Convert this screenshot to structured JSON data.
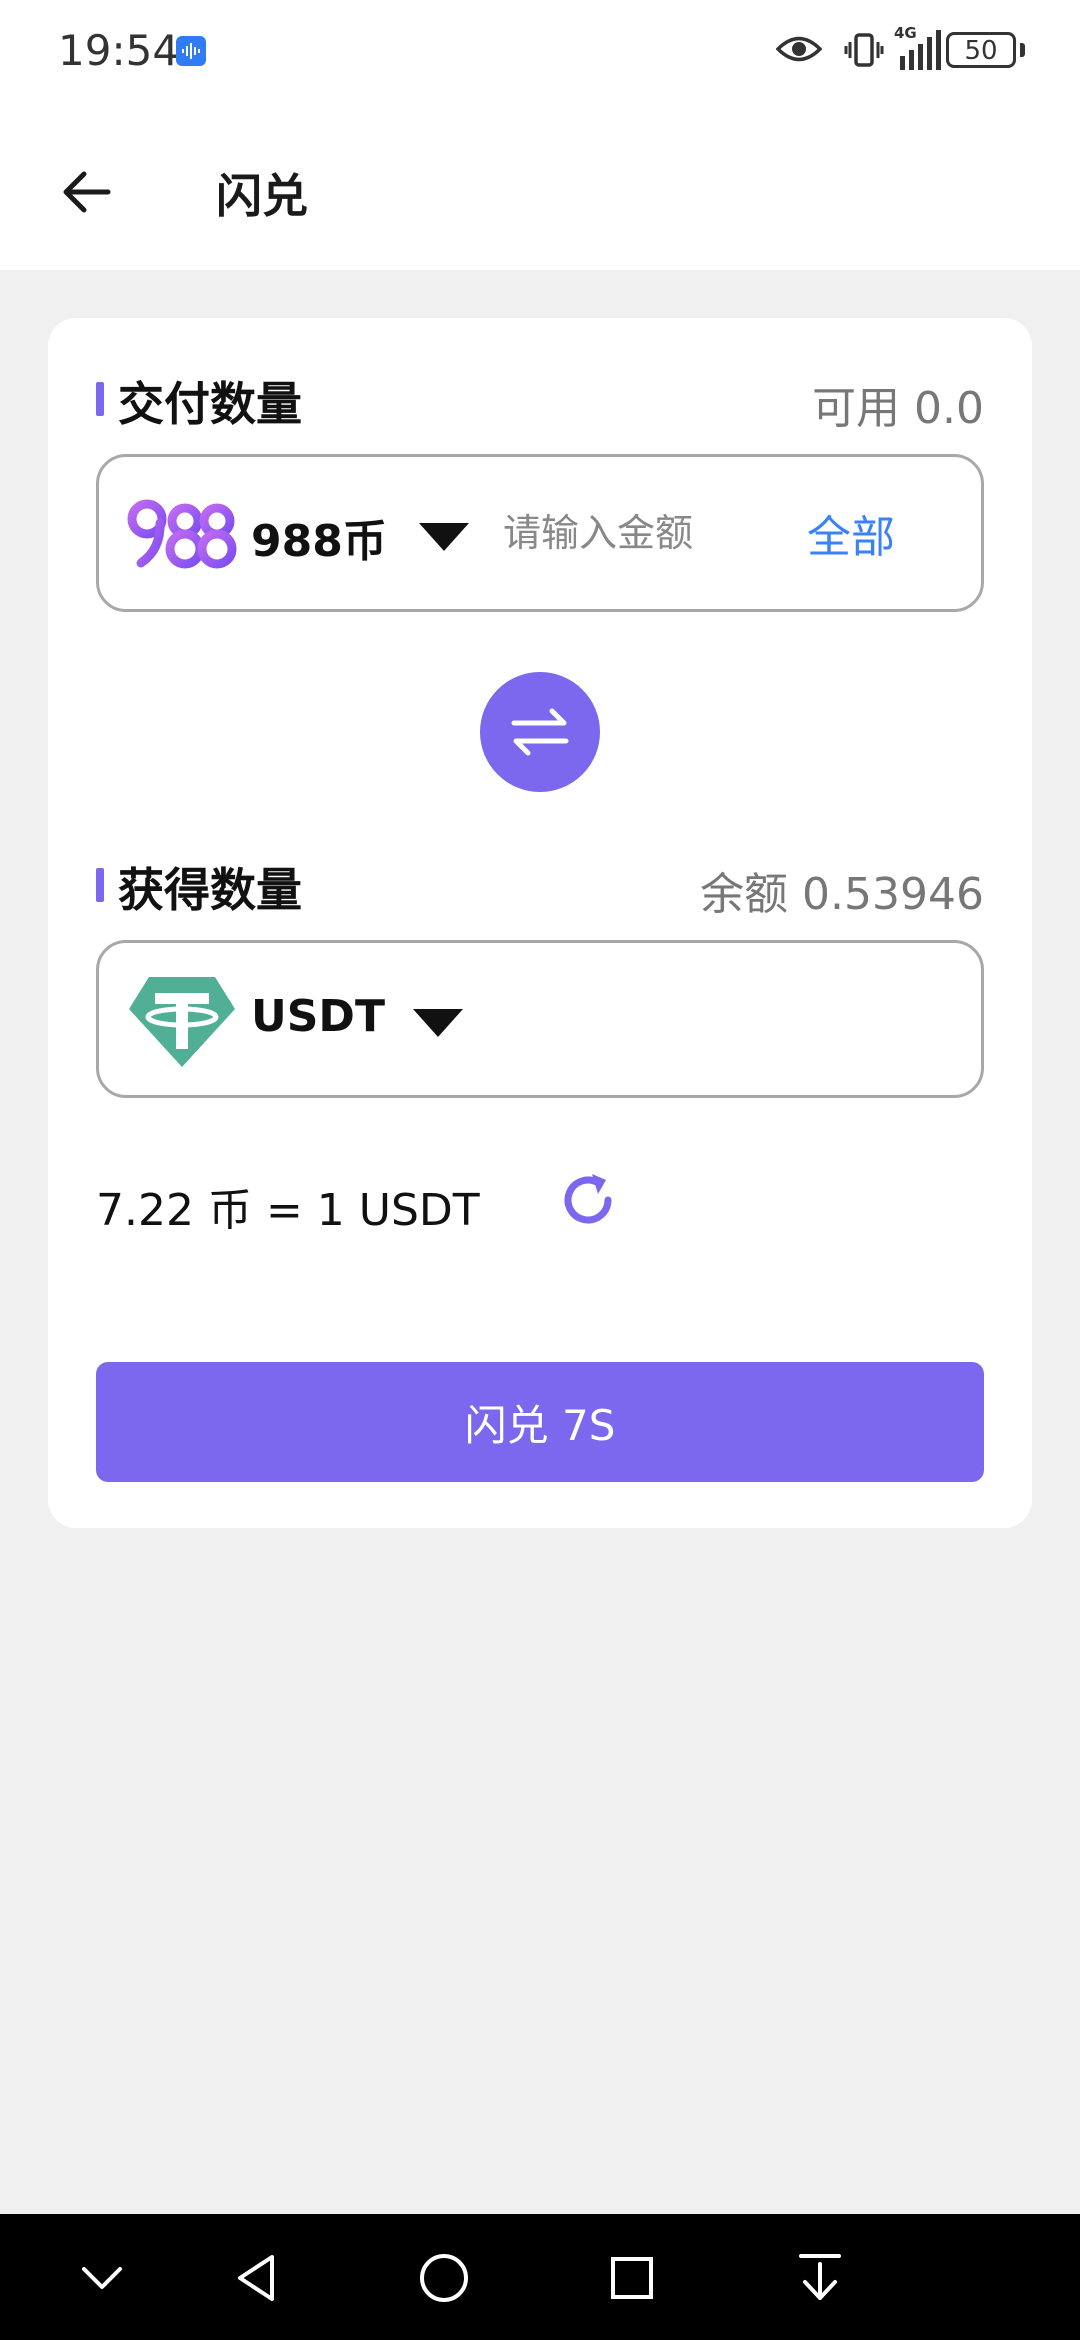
{
  "status_bar": {
    "time": "19:54",
    "network": "4G",
    "battery": "50",
    "icons": [
      "voice-icon",
      "eye-icon",
      "vibrate-icon",
      "signal-icon",
      "battery-icon"
    ]
  },
  "header": {
    "title": "闪兑",
    "back_icon": "arrow-left-icon"
  },
  "pay_section": {
    "title": "交付数量",
    "available": "可用 0.0",
    "coin_name": "988币",
    "amount_value": "",
    "amount_placeholder": "请输入金额",
    "all_label": "全部"
  },
  "receive_section": {
    "title": "获得数量",
    "balance": "余额 0.53946",
    "coin_name": "USDT"
  },
  "rate": {
    "text": "7.22 币 = 1 USDT"
  },
  "exchange_button": {
    "label": "闪兑 7S"
  },
  "colors": {
    "accent": "#7b68ee",
    "link": "#3b82f6",
    "tether": "#50af95",
    "background": "#f0f0f0"
  },
  "nav_bar": {
    "icons": [
      "chevron-down-icon",
      "back-triangle-icon",
      "home-circle-icon",
      "recents-square-icon",
      "download-arrow-icon"
    ]
  }
}
